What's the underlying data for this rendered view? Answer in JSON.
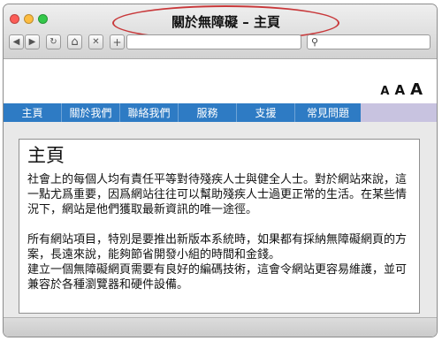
{
  "window": {
    "title": "關於無障礙 – 主頁",
    "colors": {
      "close": "#fc5d57",
      "minimize": "#fdbc40",
      "zoom": "#34c84a",
      "highlight_ring": "#c8383a"
    }
  },
  "toolbar": {
    "back_icon": "◀",
    "forward_icon": "▶",
    "reload_icon": "↻",
    "home_icon": "⌂",
    "stop_icon": "✕",
    "new_tab_icon": "+",
    "search_icon": "⚲",
    "url_value": "",
    "search_value": ""
  },
  "text_size": {
    "small": "A",
    "medium": "A",
    "large": "A"
  },
  "nav": {
    "colors": {
      "item_bg": "#2e7bc4",
      "bar_bg": "#c8c3e0"
    },
    "items": [
      {
        "label": "主頁"
      },
      {
        "label": "關於我們"
      },
      {
        "label": "聯絡我們"
      },
      {
        "label": "服務"
      },
      {
        "label": "支援"
      },
      {
        "label": "常見問題"
      }
    ]
  },
  "main": {
    "heading": "主頁",
    "paragraphs": [
      "社會上的每個人均有責任平等對待殘疾人士與健全人士。對於網站來說，這一點尤爲重要，因爲網站往往可以幫助殘疾人士過更正常的生活。在某些情況下，網站是他們獲取最新資訊的唯一途徑。",
      "所有網站項目，特別是要推出新版本系統時，如果都有採納無障礙網頁的方案，長遠來說，能夠節省開發小組的時間和金錢。",
      "建立一個無障礙網頁需要有良好的編碼技術，這會令網站更容易維護，並可兼容於各種瀏覽器和硬件設備。"
    ]
  }
}
